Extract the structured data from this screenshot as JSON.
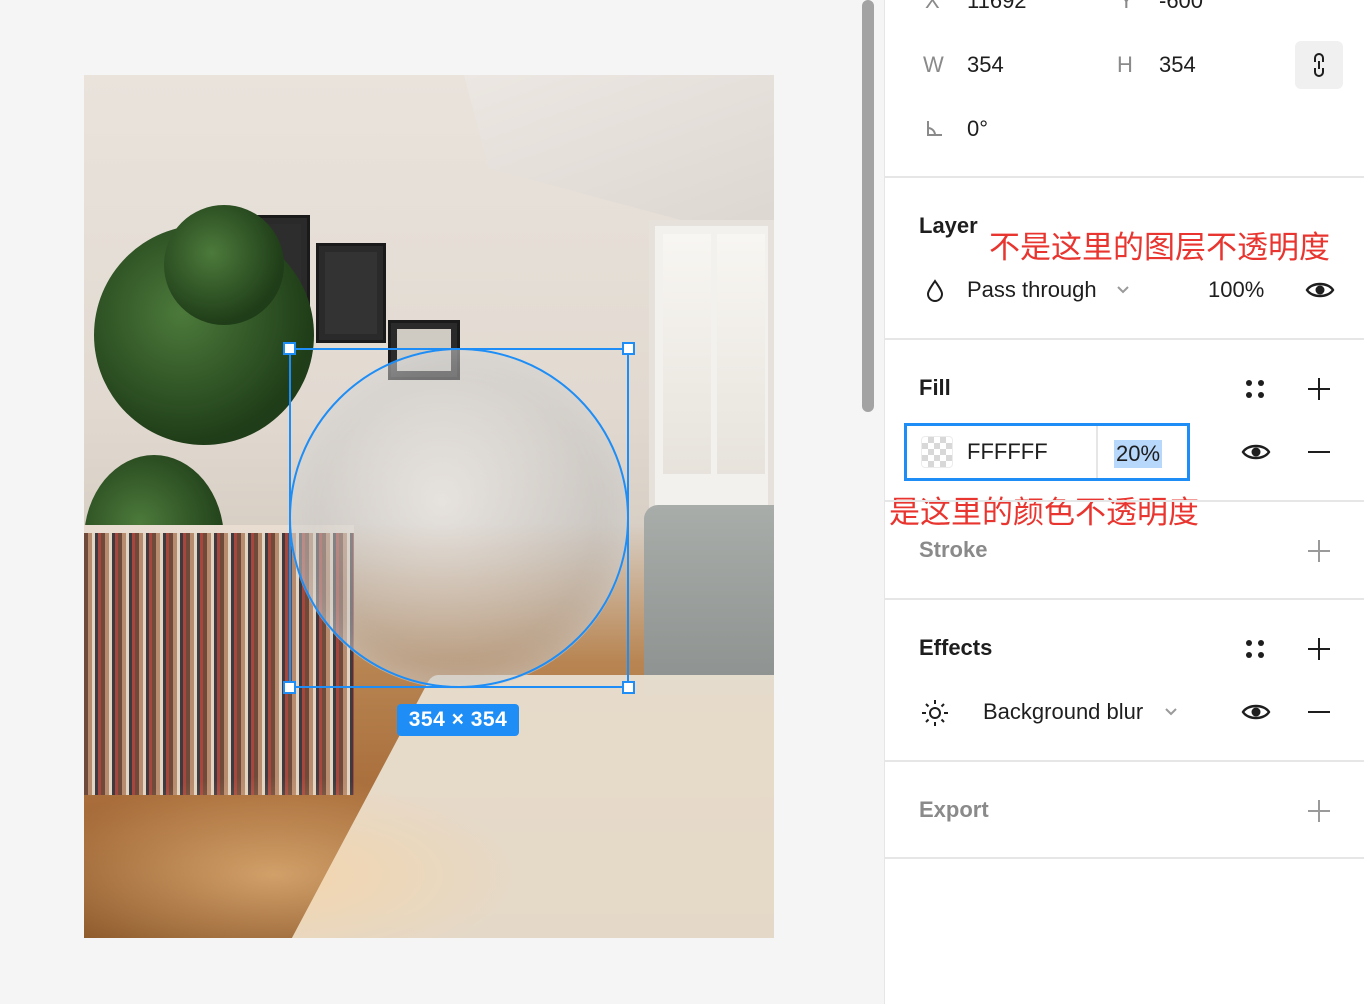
{
  "selection": {
    "dimensions": "354 × 354"
  },
  "properties": {
    "x_label": "X",
    "x_value": "11692",
    "y_label": "Y",
    "y_value": "-600",
    "w_label": "W",
    "w_value": "354",
    "h_label": "H",
    "h_value": "354",
    "rotation": "0°"
  },
  "layer": {
    "title": "Layer",
    "annotation": "不是这里的图层不透明度",
    "blend_mode": "Pass through",
    "opacity": "100%"
  },
  "fill": {
    "title": "Fill",
    "color": "FFFFFF",
    "opacity": "20%",
    "annotation": "是这里的颜色不透明度"
  },
  "stroke": {
    "title": "Stroke"
  },
  "effects": {
    "title": "Effects",
    "effect": "Background blur"
  },
  "export": {
    "title": "Export"
  },
  "colors": {
    "accent": "#1e8ef6",
    "annotation": "#e8352f"
  }
}
